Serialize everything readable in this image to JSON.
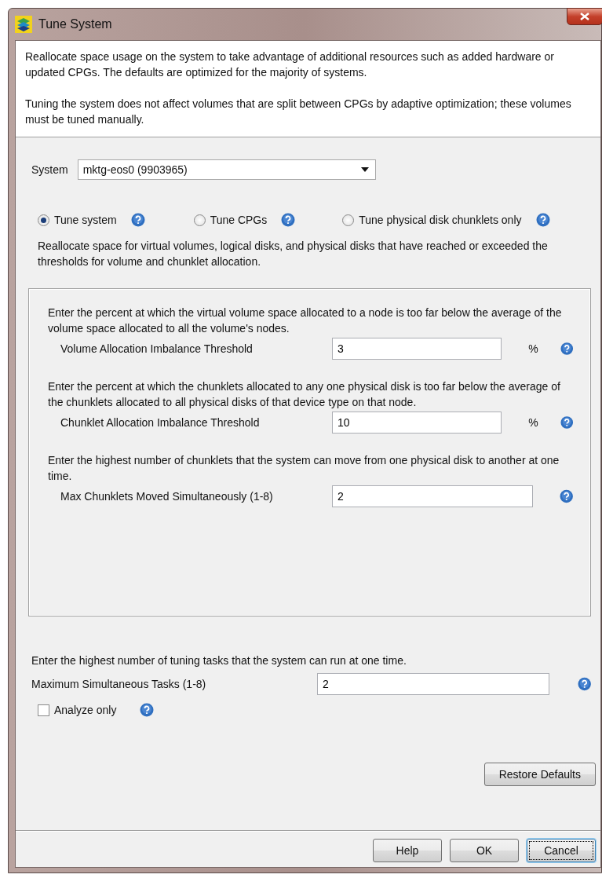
{
  "window": {
    "title": "Tune System"
  },
  "intro": [
    "Reallocate space usage on the system to take advantage of additional resources such as added hardware or updated CPGs. The defaults are optimized for the majority of systems.",
    "Tuning the system does not affect volumes that are split between CPGs by adaptive optimization; these volumes must be tuned manually."
  ],
  "system": {
    "label": "System",
    "value": "mktg-eos0 (9903965)"
  },
  "modes": [
    {
      "label": "Tune system",
      "selected": true
    },
    {
      "label": "Tune CPGs",
      "selected": false
    },
    {
      "label": "Tune physical disk chunklets only",
      "selected": false
    }
  ],
  "mode_description": "Reallocate space for virtual volumes, logical disks, and physical disks that have reached or exceeded the thresholds for volume and chunklet allocation.",
  "thresholds": [
    {
      "description": "Enter the percent at which the virtual volume space allocated to a node is too far below the average of the volume space allocated to all the volume's nodes.",
      "label": "Volume Allocation Imbalance Threshold",
      "value": "3",
      "unit": "%"
    },
    {
      "description": "Enter the percent at which the chunklets allocated to any one physical disk is too far below the average of the chunklets allocated to all physical disks of that device type on that node.",
      "label": "Chunklet Allocation Imbalance Threshold",
      "value": "10",
      "unit": "%"
    },
    {
      "description": "Enter the highest number of chunklets that the system can move from one physical disk to another at one time.",
      "label": "Max Chunklets Moved Simultaneously  (1-8)",
      "value": "2"
    }
  ],
  "tasks": {
    "description": "Enter the highest number of tuning tasks that the system can run at one time.",
    "label": "Maximum Simultaneous Tasks  (1-8)",
    "value": "2"
  },
  "analyze_only": {
    "label": "Analyze only",
    "checked": false
  },
  "restore_button": "Restore Defaults",
  "buttons": [
    {
      "label": "Help",
      "focused": false
    },
    {
      "label": "OK",
      "focused": false
    },
    {
      "label": "Cancel",
      "focused": true
    }
  ]
}
